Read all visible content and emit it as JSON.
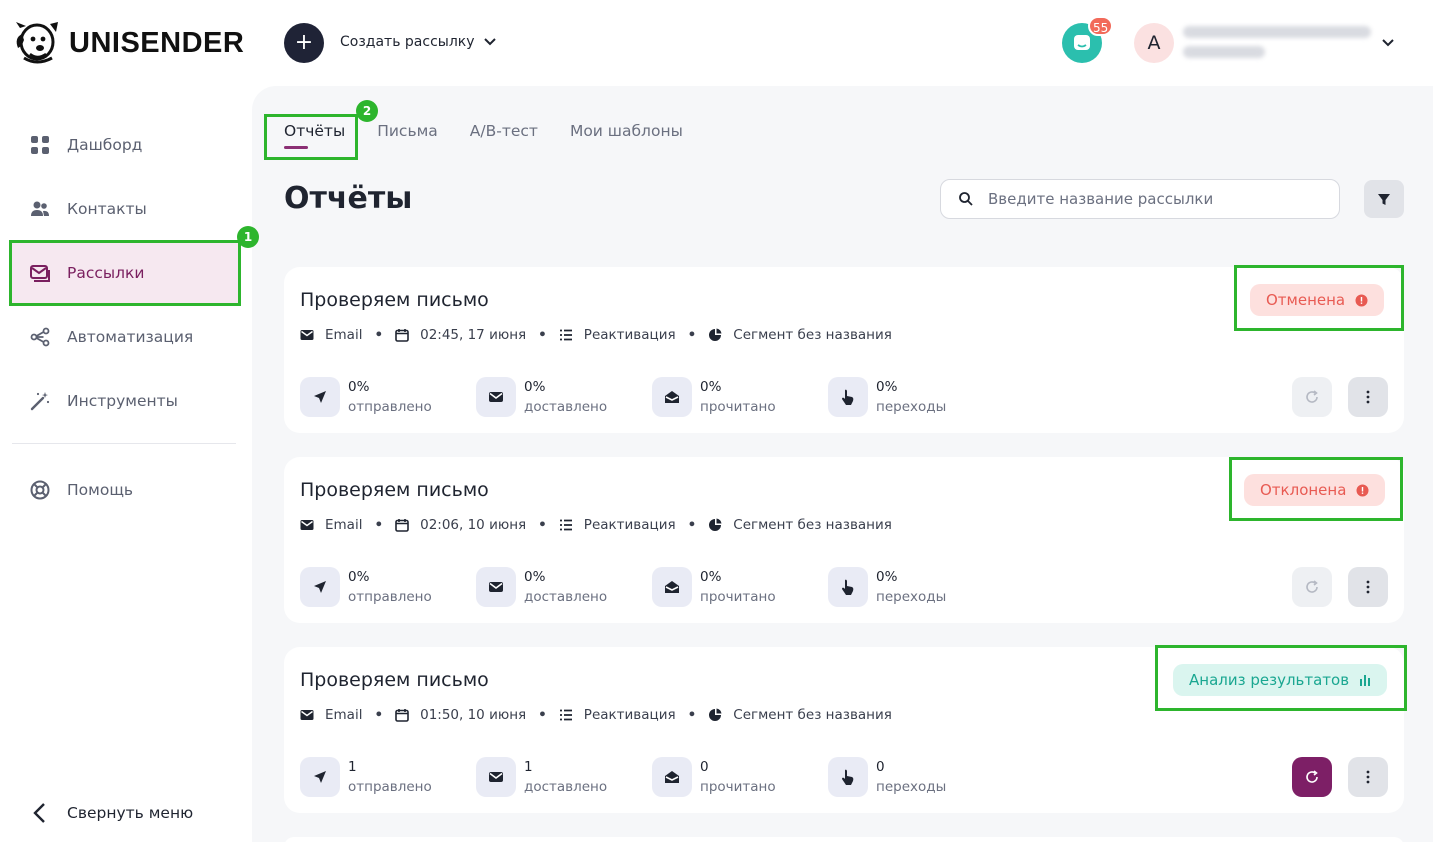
{
  "brand": {
    "name": "UNISENDER"
  },
  "topbar": {
    "create_label": "Создать рассылку",
    "notif_count": "55",
    "avatar_letter": "A"
  },
  "sidebar": {
    "items": [
      {
        "label": "Дашборд",
        "icon": "dashboard-icon"
      },
      {
        "label": "Контакты",
        "icon": "contacts-icon"
      },
      {
        "label": "Рассылки",
        "icon": "mail-icon",
        "active": true
      },
      {
        "label": "Автоматизация",
        "icon": "automation-icon"
      },
      {
        "label": "Инструменты",
        "icon": "tools-icon"
      },
      {
        "label": "Помощь",
        "icon": "help-icon"
      }
    ],
    "collapse_label": "Свернуть меню"
  },
  "tabs": [
    {
      "label": "Отчёты",
      "active": true
    },
    {
      "label": "Письма"
    },
    {
      "label": "A/B-тест"
    },
    {
      "label": "Мои шаблоны"
    }
  ],
  "page": {
    "title": "Отчёты",
    "search_placeholder": "Введите название рассылки"
  },
  "highlights": {
    "one": "1",
    "two": "2"
  },
  "campaigns": [
    {
      "title": "Проверяем письмо",
      "channel": "Email",
      "datetime": "02:45, 17 июня",
      "type": "Реактивация",
      "segment": "Сегмент без названия",
      "status": "Отменена",
      "status_color": "#e85a52",
      "stats": [
        {
          "value": "0%",
          "label": "отправлено"
        },
        {
          "value": "0%",
          "label": "доставлено"
        },
        {
          "value": "0%",
          "label": "прочитано"
        },
        {
          "value": "0%",
          "label": "переходы"
        }
      ]
    },
    {
      "title": "Проверяем письмо",
      "channel": "Email",
      "datetime": "02:06, 10 июня",
      "type": "Реактивация",
      "segment": "Сегмент без названия",
      "status": "Отклонена",
      "status_color": "#e85a52",
      "stats": [
        {
          "value": "0%",
          "label": "отправлено"
        },
        {
          "value": "0%",
          "label": "доставлено"
        },
        {
          "value": "0%",
          "label": "прочитано"
        },
        {
          "value": "0%",
          "label": "переходы"
        }
      ]
    },
    {
      "title": "Проверяем письмо",
      "channel": "Email",
      "datetime": "01:50, 10 июня",
      "type": "Реактивация",
      "segment": "Сегмент без названия",
      "status": "Анализ результатов",
      "status_color": "#1aa791",
      "stats": [
        {
          "value": "1",
          "label": "отправлено"
        },
        {
          "value": "1",
          "label": "доставлено"
        },
        {
          "value": "0",
          "label": "прочитано"
        },
        {
          "value": "0",
          "label": "переходы"
        }
      ]
    }
  ],
  "colors": {
    "accent": "#7d1f66",
    "highlight": "#2db52d"
  }
}
